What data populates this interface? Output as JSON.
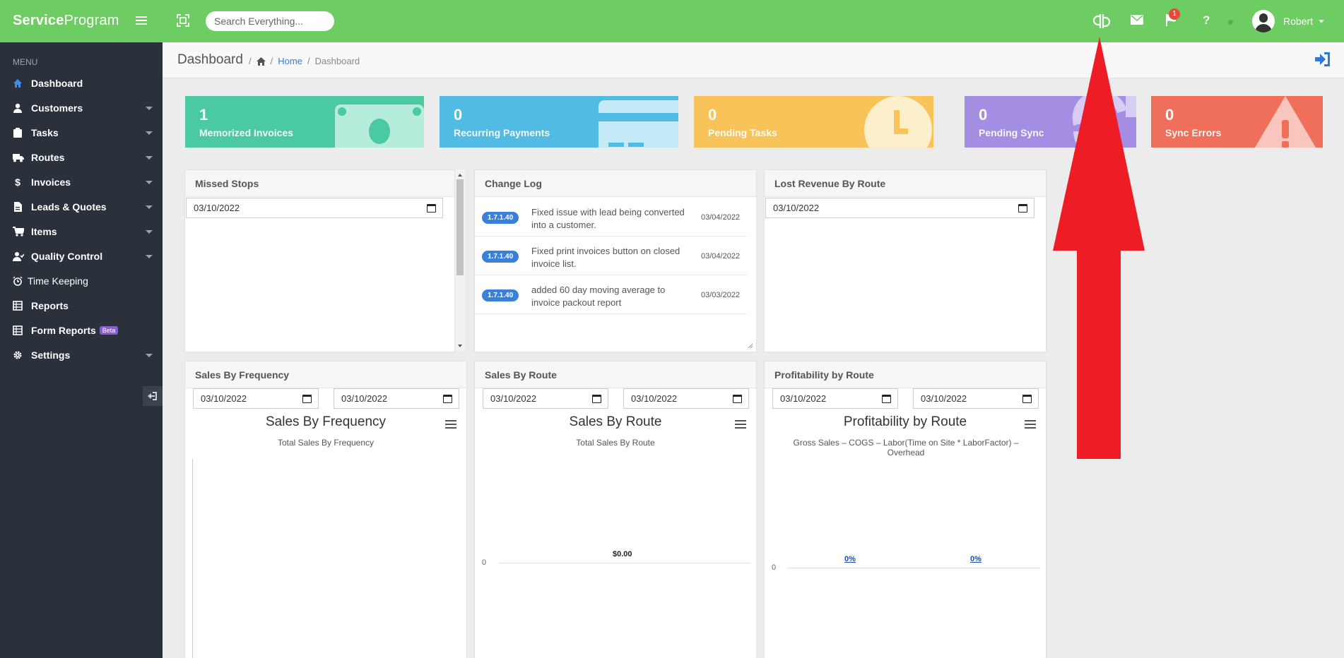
{
  "topbar": {
    "brand_bold": "Service",
    "brand_rest": "Program",
    "search_placeholder": "Search Everything...",
    "notification_count": "1",
    "user_name": "Robert",
    "icons": [
      "menu-icon",
      "fullscreen-icon",
      "quickbooks-icon",
      "mail-icon",
      "flag-icon",
      "help-icon",
      "status-dot-icon"
    ]
  },
  "sidebar": {
    "menu_label": "MENU",
    "items": [
      {
        "label": "Dashboard",
        "icon": "home-icon"
      },
      {
        "label": "Customers",
        "icon": "user-icon"
      },
      {
        "label": "Tasks",
        "icon": "clipboard-icon"
      },
      {
        "label": "Routes",
        "icon": "truck-icon"
      },
      {
        "label": "Invoices",
        "icon": "dollar-icon"
      },
      {
        "label": "Leads & Quotes",
        "icon": "document-icon"
      },
      {
        "label": "Items",
        "icon": "cart-icon"
      },
      {
        "label": "Quality Control",
        "icon": "user-check-icon"
      },
      {
        "label": "Time Keeping",
        "icon": "alarm-icon"
      },
      {
        "label": "Reports",
        "icon": "report-icon"
      },
      {
        "label": "Form Reports",
        "icon": "form-icon",
        "badge": "Beta"
      },
      {
        "label": "Settings",
        "icon": "gear-icon"
      }
    ]
  },
  "header": {
    "title": "Dashboard",
    "breadcrumb_home": "Home",
    "breadcrumb_current": "Dashboard"
  },
  "tiles": [
    {
      "value": "1",
      "label": "Memorized Invoices",
      "color": "#4bc9a4"
    },
    {
      "value": "0",
      "label": "Recurring Payments",
      "color": "#52bbe3"
    },
    {
      "value": "0",
      "label": "Pending Tasks",
      "color": "#f8c45a"
    },
    {
      "value": "0",
      "label": "Pending Sync",
      "color": "#a38ee4"
    },
    {
      "value": "0",
      "label": "Sync Errors",
      "color": "#ef6f5b"
    }
  ],
  "panels": {
    "missed_stops": {
      "title": "Missed Stops",
      "date": "03/10/2022"
    },
    "change_log": {
      "title": "Change Log",
      "entries": [
        {
          "version": "1.7.1.40",
          "text": "Fixed issue with lead being converted into a customer.",
          "date": "03/04/2022"
        },
        {
          "version": "1.7.1.40",
          "text": "Fixed print invoices button on closed invoice list.",
          "date": "03/04/2022"
        },
        {
          "version": "1.7.1.40",
          "text": "added 60 day moving average to invoice packout report",
          "date": "03/03/2022"
        }
      ]
    },
    "lost_revenue": {
      "title": "Lost Revenue By Route",
      "date": "03/10/2022"
    },
    "sales_frequency": {
      "title": "Sales By Frequency",
      "date_from": "03/10/2022",
      "date_to": "03/10/2022",
      "chart_title": "Sales By Frequency",
      "chart_subtitle": "Total Sales By Frequency"
    },
    "sales_route": {
      "title": "Sales By Route",
      "date_from": "03/10/2022",
      "date_to": "03/10/2022",
      "chart_title": "Sales By Route",
      "chart_subtitle": "Total Sales By Route",
      "axis_zero": "0",
      "data_label": "$0.00"
    },
    "profitability": {
      "title": "Profitability by Route",
      "date_from": "03/10/2022",
      "date_to": "03/10/2022",
      "chart_title": "Profitability by Route",
      "chart_subtitle": "Gross Sales – COGS – Labor(Time on Site * LaborFactor) – Overhead",
      "axis_zero": "0",
      "label_a": "0%",
      "label_b": "0%"
    }
  },
  "annotation_color": "#ee1c25"
}
